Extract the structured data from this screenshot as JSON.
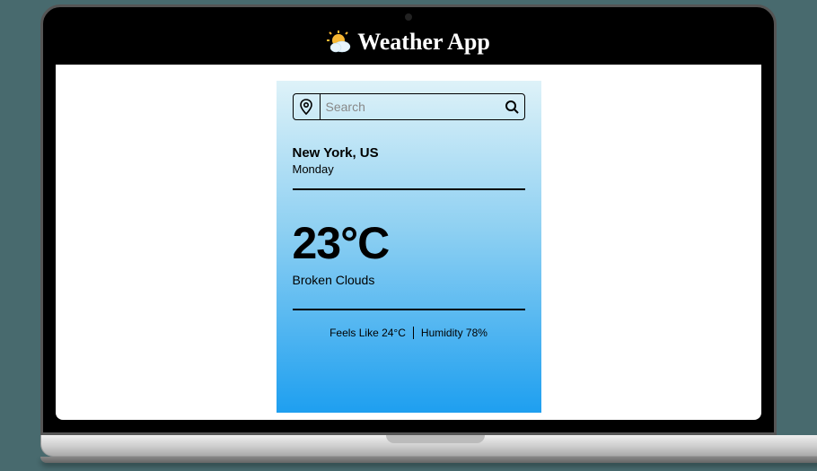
{
  "header": {
    "title": "Weather App",
    "icon": "sun-cloud-icon"
  },
  "search": {
    "placeholder": "Search",
    "value": ""
  },
  "weather": {
    "location": "New York, US",
    "day": "Monday",
    "temperature": "23°C",
    "condition": "Broken Clouds",
    "feels_like": "Feels Like 24°C",
    "humidity": "Humidity 78%"
  }
}
